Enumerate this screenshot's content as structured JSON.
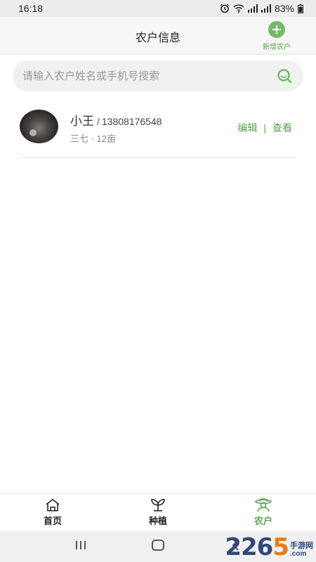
{
  "status_bar": {
    "time": "16:18",
    "battery": "83%"
  },
  "header": {
    "title": "农户信息",
    "add_label": "新增农户"
  },
  "search": {
    "placeholder": "请输入农户姓名或手机号搜索"
  },
  "farmers": [
    {
      "name": "小王",
      "separator": "/",
      "phone": "13808176548",
      "meta": "三七 · 12亩",
      "edit_label": "编辑",
      "action_divider": "|",
      "view_label": "查看"
    }
  ],
  "bottom_nav": {
    "items": [
      {
        "label": "首页",
        "icon": "home-icon",
        "active": false
      },
      {
        "label": "种植",
        "icon": "sprout-icon",
        "active": false
      },
      {
        "label": "农户",
        "icon": "farmer-icon",
        "active": true
      }
    ]
  },
  "colors": {
    "accent": "#5aa34f",
    "accent_light": "#74b96a"
  },
  "watermark": {
    "number_a": "22",
    "number_b": "6",
    "number_c": "5",
    "cn": "手游网",
    "domain": ".com"
  }
}
